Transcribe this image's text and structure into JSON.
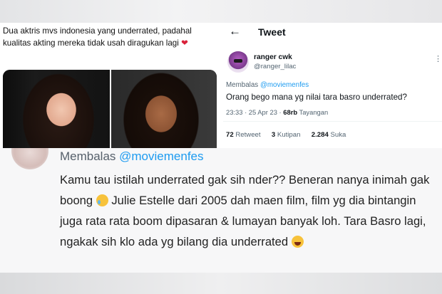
{
  "left_tweet": {
    "text": "Dua aktris mvs indonesia yang underrated, padahal kualitas akting mereka tidak usah diragukan lagi",
    "heart": "❤"
  },
  "right_tweet": {
    "header_title": "Tweet",
    "back_icon": "←",
    "display_name": "ranger cwk",
    "handle": "@ranger_lilac",
    "more_icon": "⋮",
    "reply_prefix": "Membalas",
    "reply_mention": "@moviemenfes",
    "body": "Orang bego mana yg nilai tara basro underrated?",
    "meta_time": "23:33 · 25 Apr 23 · ",
    "meta_views": "68rb",
    "meta_views_label": " Tayangan",
    "stats": {
      "retweet_count": "72",
      "retweet_label": " Retweet",
      "quote_count": "3",
      "quote_label": " Kutipan",
      "like_count": "2.284",
      "like_label": " Suka"
    }
  },
  "zoomed_reply": {
    "reply_prefix": "Membalas ",
    "reply_mention": "@moviemenfes",
    "text_part1": "Kamu tau istilah underrated gak sih nder?? Beneran nanya inimah gak boong ",
    "text_part2": " Julie Estelle dari 2005 dah maen film, film yg dia bintangin juga rata rata boom dipasaran & lumayan banyak loh. Tara Basro lagi, ngakak sih klo ada yg bilang dia underrated ",
    "emoji1": "crying-face-icon",
    "emoji2": "laughing-face-icon"
  },
  "colors": {
    "accent": "#1d9bf0",
    "heart": "#d9213a",
    "secondary_text": "#536471"
  }
}
